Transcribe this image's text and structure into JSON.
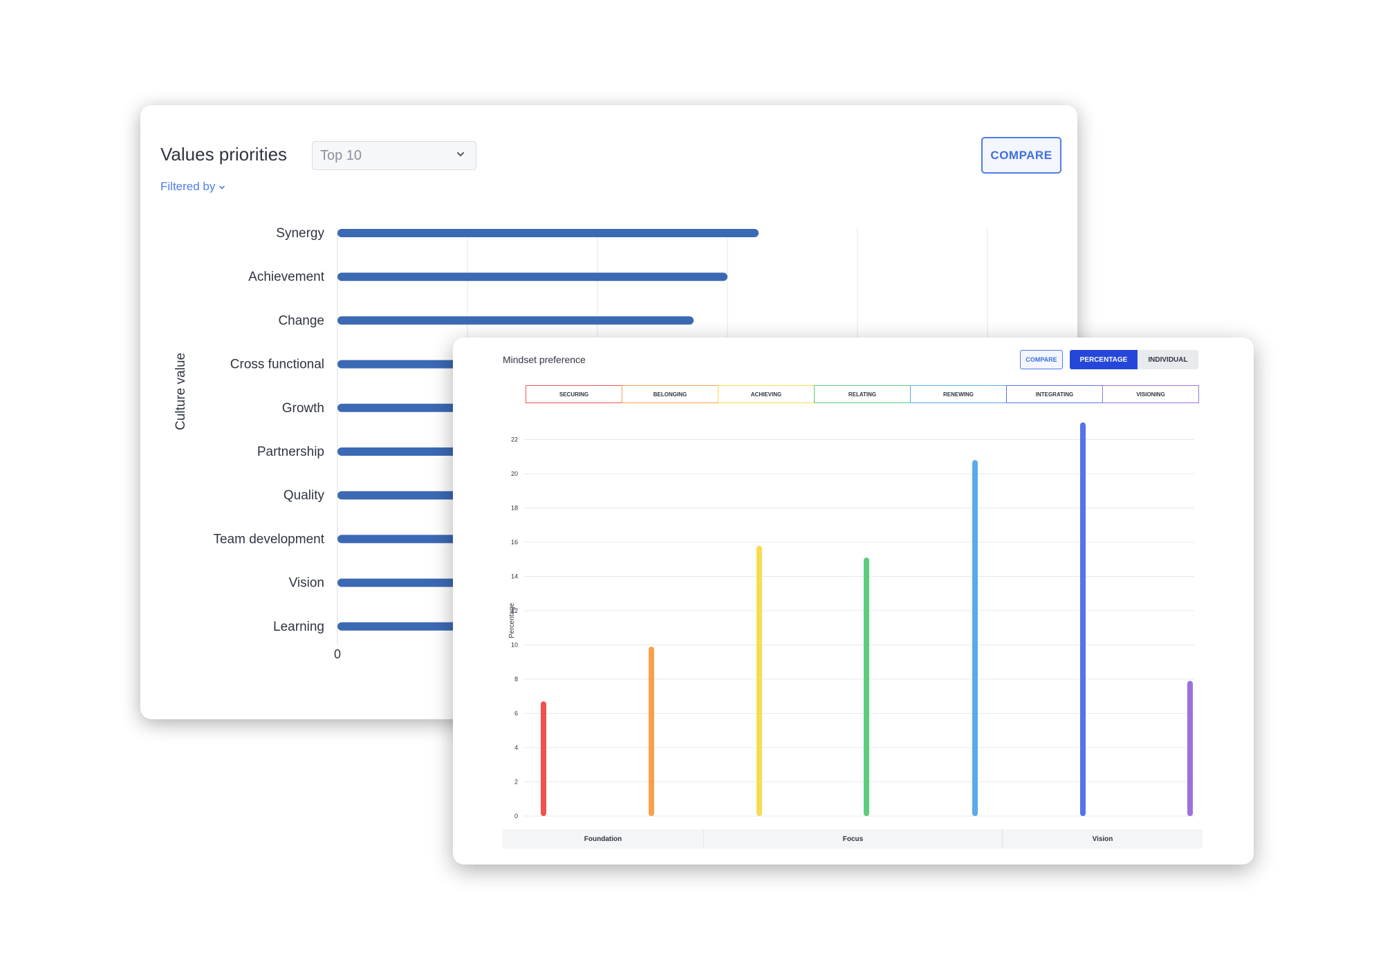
{
  "values_priorities": {
    "title": "Values priorities",
    "select_value": "Top 10",
    "filter_label": "Filtered by",
    "compare_label": "COMPARE",
    "y_axis_label": "Culture value"
  },
  "mindset": {
    "title": "Mindset preference",
    "compare_label": "COMPARE",
    "percentage_label": "PERCENTAGE",
    "individual_label": "INDIVIDUAL",
    "y_axis_label": "Percentage",
    "legend": [
      {
        "label": "SECURING",
        "color": "#ef5350"
      },
      {
        "label": "BELONGING",
        "color": "#f7a14a"
      },
      {
        "label": "ACHIEVING",
        "color": "#f7dc52"
      },
      {
        "label": "RELATING",
        "color": "#5ccd7c"
      },
      {
        "label": "RENEWING",
        "color": "#5aaaea"
      },
      {
        "label": "INTEGRATING",
        "color": "#5773e6"
      },
      {
        "label": "VISIONING",
        "color": "#9a72e0"
      }
    ],
    "groups": [
      "Foundation",
      "Focus",
      "Vision"
    ]
  },
  "chart_data": [
    {
      "type": "bar",
      "orientation": "horizontal",
      "categories": [
        "Synergy",
        "Achievement",
        "Change",
        "Cross functional",
        "Growth",
        "Partnership",
        "Quality",
        "Team development",
        "Vision",
        "Learning"
      ],
      "values": [
        16.2,
        15,
        13.7,
        null,
        null,
        null,
        null,
        null,
        null,
        null
      ],
      "x_tick_labels": [
        "0"
      ],
      "xlim": [
        0,
        25
      ],
      "grid": true,
      "color": "#3c69b4",
      "ylabel": "Culture value"
    },
    {
      "type": "bar",
      "categories": [
        "SECURING",
        "BELONGING",
        "ACHIEVING",
        "RELATING",
        "RENEWING",
        "INTEGRATING",
        "VISIONING"
      ],
      "values": [
        6.7,
        9.9,
        15.8,
        15.1,
        20.8,
        23,
        7.9
      ],
      "colors": [
        "#ef5350",
        "#f7a14a",
        "#f7dc52",
        "#5ccd7c",
        "#5aaaea",
        "#5773e6",
        "#9a72e0"
      ],
      "y_ticks": [
        0,
        2,
        4,
        6,
        8,
        10,
        12,
        14,
        16,
        18,
        20,
        22
      ],
      "ylim": [
        0,
        23
      ],
      "ylabel": "Percentage",
      "grid": true
    }
  ]
}
